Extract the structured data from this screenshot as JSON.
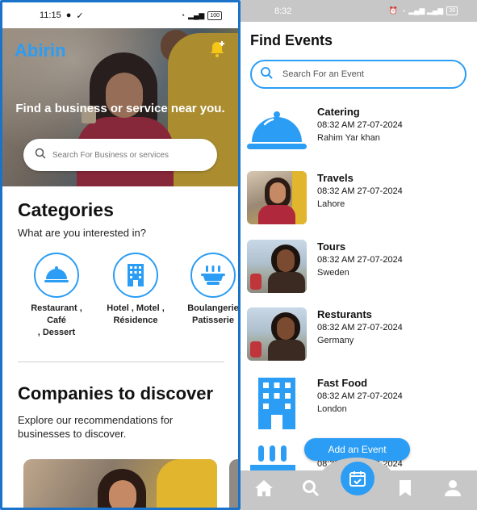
{
  "left_app": {
    "status_bar": {
      "time": "11:15",
      "battery": "100"
    },
    "brand": "Abirin",
    "hero_title": "Find a business or service near you.",
    "search_placeholder": "Search For Business or services",
    "categories": {
      "title": "Categories",
      "subtitle": "What are you interested in?",
      "items": [
        {
          "line1": "Restaurant , Café",
          "line2": ", Dessert",
          "icon": "cloche-icon"
        },
        {
          "line1": "Hotel , Motel ,",
          "line2": "Résidence",
          "icon": "building-icon"
        },
        {
          "line1": "Boulangerie",
          "line2": "Patisserie",
          "icon": "bakery-icon"
        }
      ]
    },
    "companies": {
      "title": "Companies to discover",
      "subtitle": "Explore our recommendations for businesses to discover."
    }
  },
  "right_app": {
    "status_bar": {
      "time": "8:32",
      "battery": "39"
    },
    "title": "Find Events",
    "search_placeholder": "Search For an Event",
    "events": [
      {
        "name": "Catering",
        "datetime": "08:32 AM 27-07-2024",
        "location": "Rahim Yar khan",
        "thumb": "cloche-icon"
      },
      {
        "name": "Travels",
        "datetime": "08:32 AM 27-07-2024",
        "location": "Lahore",
        "thumb": "photo-woman-laughing"
      },
      {
        "name": "Tours",
        "datetime": "08:32 AM 27-07-2024",
        "location": "Sweden",
        "thumb": "photo-woman-smiling"
      },
      {
        "name": "Resturants",
        "datetime": "08:32 AM 27-07-2024",
        "location": "Germany",
        "thumb": "photo-woman-smiling"
      },
      {
        "name": "Fast Food",
        "datetime": "08:32 AM 27-07-2024",
        "location": "London",
        "thumb": "building-icon"
      },
      {
        "name": "",
        "datetime": "08:32 AM 27-07-2024",
        "location": "",
        "thumb": "bakery-icon"
      }
    ],
    "add_event_label": "Add an Event",
    "nav": [
      "home-icon",
      "search-icon",
      "calendar-check-icon",
      "bookmark-icon",
      "person-icon"
    ],
    "accent_color": "#2b9df4"
  }
}
